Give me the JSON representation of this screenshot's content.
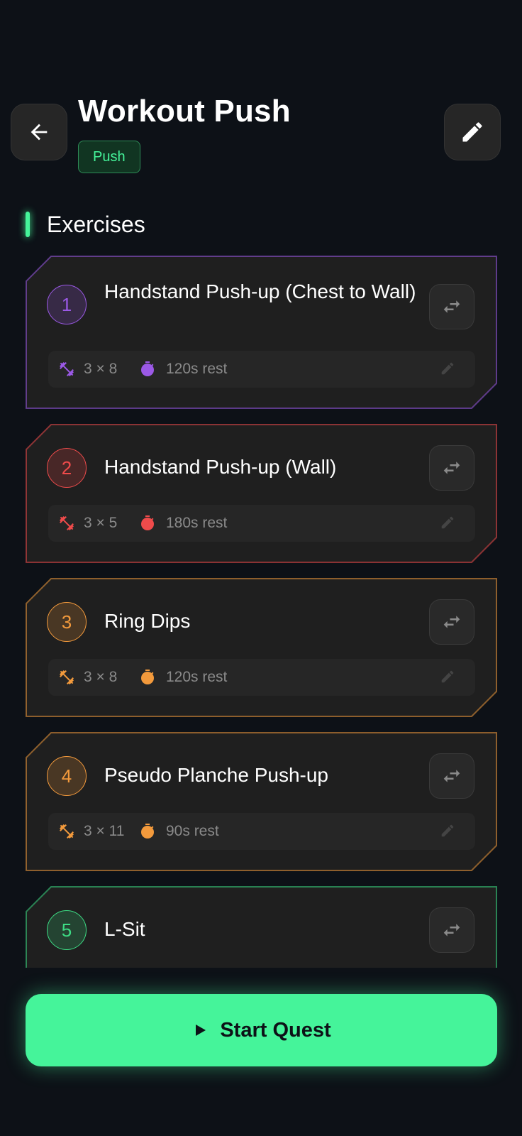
{
  "header": {
    "title": "Workout Push",
    "tag": "Push"
  },
  "section": {
    "label": "Exercises"
  },
  "exercises": [
    {
      "number": "1",
      "name": "Handstand Push-up (Chest to Wall)",
      "sets_reps": "3 × 8",
      "rest": "120s rest",
      "color": "#9b59e6"
    },
    {
      "number": "2",
      "name": "Handstand Push-up (Wall)",
      "sets_reps": "3 × 5",
      "rest": "180s rest",
      "color": "#ef4b4b"
    },
    {
      "number": "3",
      "name": "Ring Dips",
      "sets_reps": "3 × 8",
      "rest": "120s rest",
      "color": "#f39a3c"
    },
    {
      "number": "4",
      "name": "Pseudo Planche Push-up",
      "sets_reps": "3 × 11",
      "rest": "90s rest",
      "color": "#f39a3c"
    },
    {
      "number": "5",
      "name": "L-Sit",
      "sets_reps": "",
      "rest": "",
      "color": "#3ddc84"
    }
  ],
  "actions": {
    "start_label": "Start Quest"
  },
  "colors": {
    "accent": "#45f49a",
    "background": "#0d1117",
    "card": "#1f1f1f"
  }
}
